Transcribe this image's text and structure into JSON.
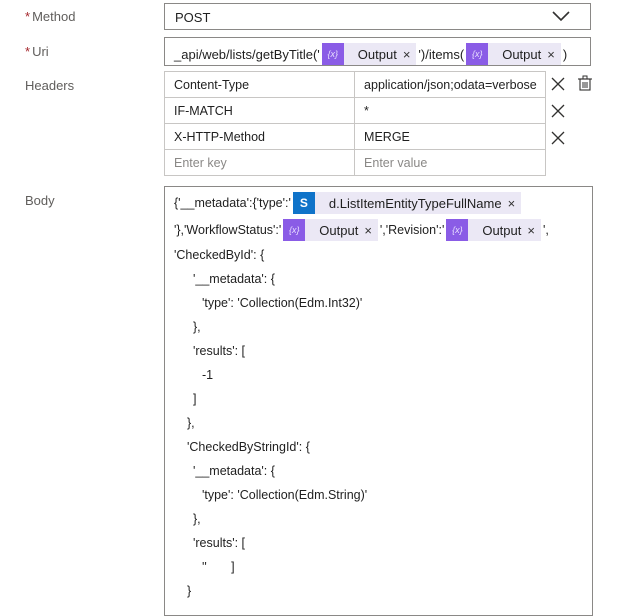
{
  "method": {
    "label": "Method",
    "value": "POST"
  },
  "uri": {
    "label": "Uri",
    "prefix": "_api/web/lists/getByTitle('",
    "token1": "Output",
    "middle": "')/items(",
    "token2": "Output",
    "suffix": ")"
  },
  "headers": {
    "label": "Headers",
    "rows": [
      {
        "key": "Content-Type",
        "value": "application/json;odata=verbose"
      },
      {
        "key": "IF-MATCH",
        "value": "*"
      },
      {
        "key": "X-HTTP-Method",
        "value": "MERGE"
      }
    ],
    "key_placeholder": "Enter key",
    "value_placeholder": "Enter value"
  },
  "body": {
    "label": "Body",
    "line1_prefix": "{'__metadata':{'type':'",
    "line1_token": "d.ListItemEntityTypeFullName",
    "line2_prefix": "'},'WorkflowStatus':'",
    "line2_token1": "Output",
    "line2_middle": "','Revision':'",
    "line2_token2": "Output",
    "line2_suffix": "',",
    "lines": [
      "'CheckedById': {",
      "'__metadata': {",
      "'type': 'Collection(Edm.Int32)'",
      "},",
      "'results': [",
      "-1",
      "]",
      "},",
      "'CheckedByStringId': {",
      "'__metadata': {",
      "'type': 'Collection(Edm.String)'",
      "},",
      "'results': [",
      "''       ]",
      "}"
    ]
  },
  "icons": {
    "expression": "{x}",
    "sharepoint": "S",
    "remove": "×"
  },
  "colors": {
    "expression_token": "#8a5ce6",
    "sharepoint_token": "#0f73c9",
    "token_bg": "#ebe8f5",
    "required": "#a4262c"
  }
}
